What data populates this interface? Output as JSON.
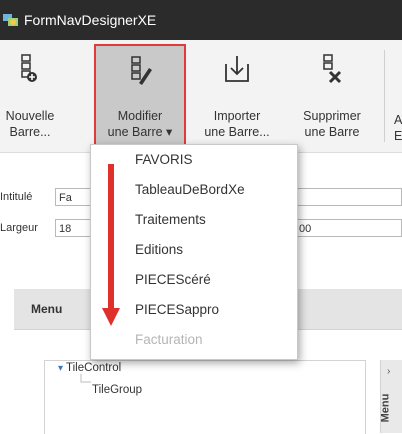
{
  "window": {
    "title": "FormNavDesignerXE"
  },
  "ribbon": {
    "buttons": [
      {
        "line1": "Nouvelle",
        "line2": "Barre..."
      },
      {
        "line1": "Modifier",
        "line2": "une Barre ▾"
      },
      {
        "line1": "Importer",
        "line2": "une Barre..."
      },
      {
        "line1": "Supprimer",
        "line2": "une Barre"
      }
    ],
    "partial_label1": "A",
    "partial_label2": "E"
  },
  "form": {
    "intitule_label": "Intitulé",
    "intitule_value": "Fa",
    "largeur_label": "Largeur",
    "largeur_value": "18",
    "second_value": "00"
  },
  "dropdown": {
    "items": [
      "FAVORIS",
      "TableauDeBordXe",
      "Traitements",
      "Editions",
      "PIECEScéré",
      "PIECESappro",
      "Facturation"
    ]
  },
  "panel": {
    "title": "Menu",
    "vtab_label": "Menu"
  },
  "tree": {
    "root": "TileControl",
    "child": "TileGroup"
  }
}
